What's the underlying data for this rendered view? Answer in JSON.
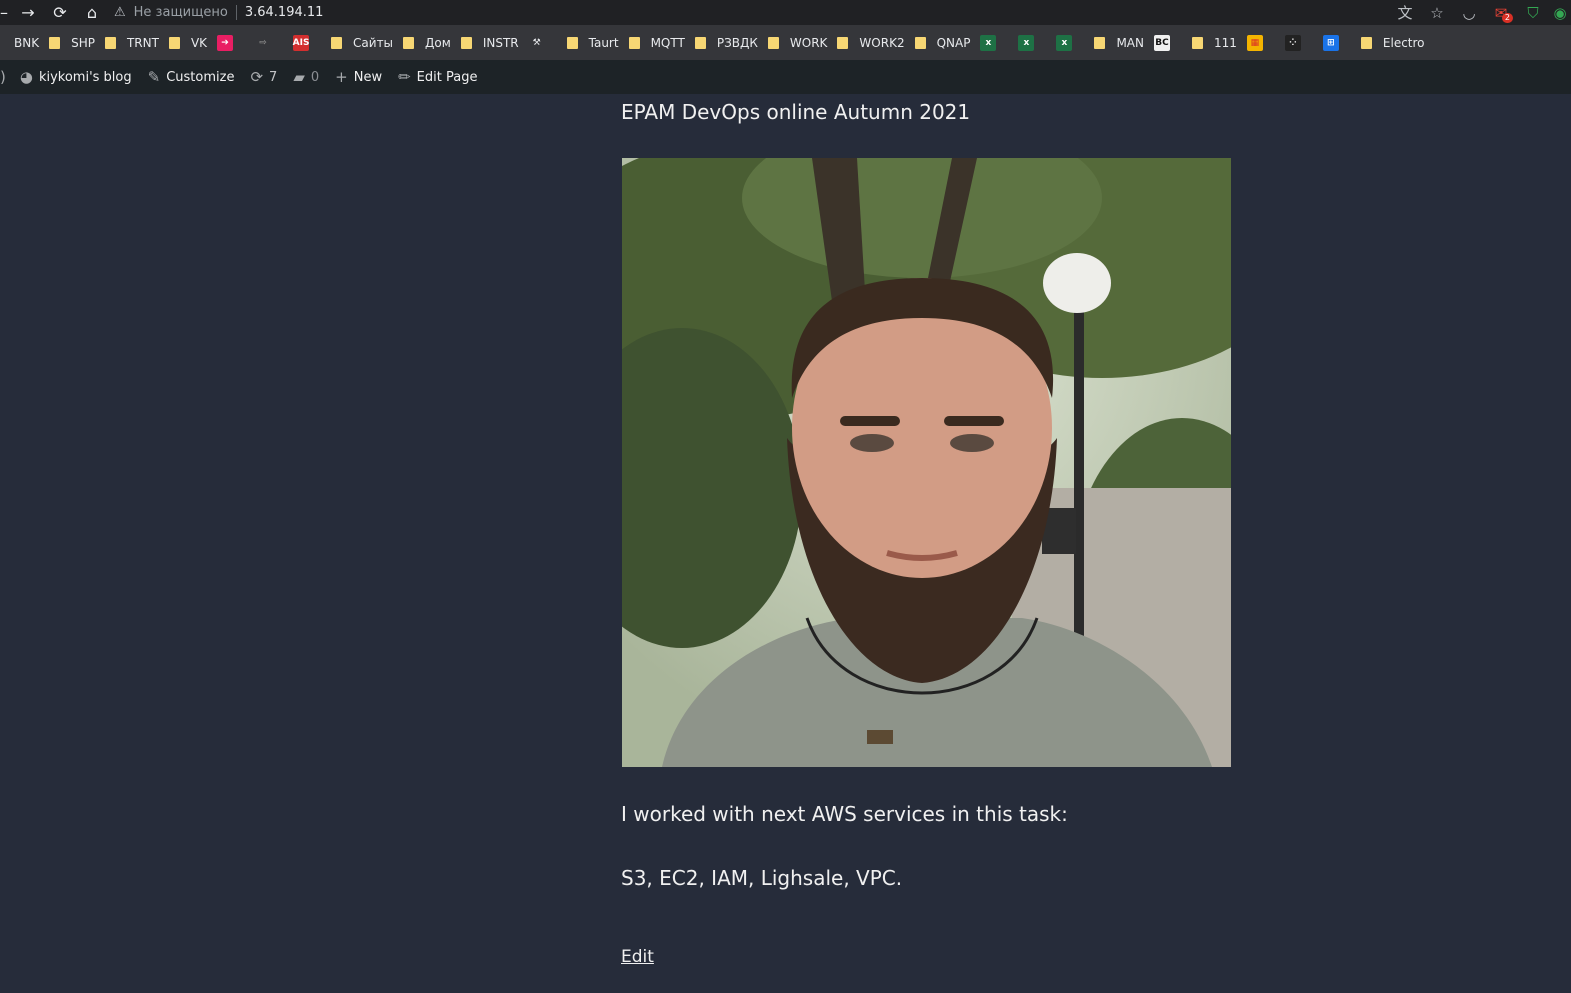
{
  "browser": {
    "security_label": "Не защищено",
    "url": "3.64.194.11",
    "mail_badge": "2"
  },
  "bookmarks": [
    {
      "label": "BNK",
      "icon": "folder-icon"
    },
    {
      "label": "SHP",
      "icon": "folder-icon"
    },
    {
      "label": "TRNT",
      "icon": "folder-icon"
    },
    {
      "label": "VK",
      "icon": "folder-icon"
    },
    {
      "label": "",
      "icon": "arrow-favicon"
    },
    {
      "label": "",
      "icon": "feed-favicon"
    },
    {
      "label": "",
      "icon": "ais-favicon"
    },
    {
      "label": "Сайты",
      "icon": "folder-icon"
    },
    {
      "label": "Дом",
      "icon": "folder-icon"
    },
    {
      "label": "INSTR",
      "icon": "folder-icon"
    },
    {
      "label": "",
      "icon": "tool-favicon"
    },
    {
      "label": "Taurt",
      "icon": "folder-icon"
    },
    {
      "label": "MQTT",
      "icon": "folder-icon"
    },
    {
      "label": "РЗВДК",
      "icon": "folder-icon"
    },
    {
      "label": "WORK",
      "icon": "folder-icon"
    },
    {
      "label": "WORK2",
      "icon": "folder-icon"
    },
    {
      "label": "QNAP",
      "icon": "folder-icon"
    },
    {
      "label": "",
      "icon": "excel-favicon"
    },
    {
      "label": "",
      "icon": "excel-favicon"
    },
    {
      "label": "",
      "icon": "excel-favicon"
    },
    {
      "label": "MAN",
      "icon": "folder-icon"
    },
    {
      "label": "",
      "icon": "bc-favicon"
    },
    {
      "label": "111",
      "icon": "folder-icon"
    },
    {
      "label": "",
      "icon": "color-grid-favicon"
    },
    {
      "label": "",
      "icon": "dots-favicon"
    },
    {
      "label": "",
      "icon": "blue-grid-favicon"
    },
    {
      "label": "Electro",
      "icon": "folder-icon"
    }
  ],
  "wp_admin_bar": {
    "site_name": "kiykomi's blog",
    "customize": "Customize",
    "updates_count": "7",
    "comments_count": "0",
    "new": "New",
    "edit_page": "Edit Page"
  },
  "post": {
    "heading": "EPAM DevOps online Autumn 2021",
    "photo_alt": "profile-photo",
    "paragraph1": "I worked with next AWS services in this task:",
    "paragraph2": "S3, EC2, IAM, Lighsale, VPC.",
    "edit_link": "Edit"
  }
}
